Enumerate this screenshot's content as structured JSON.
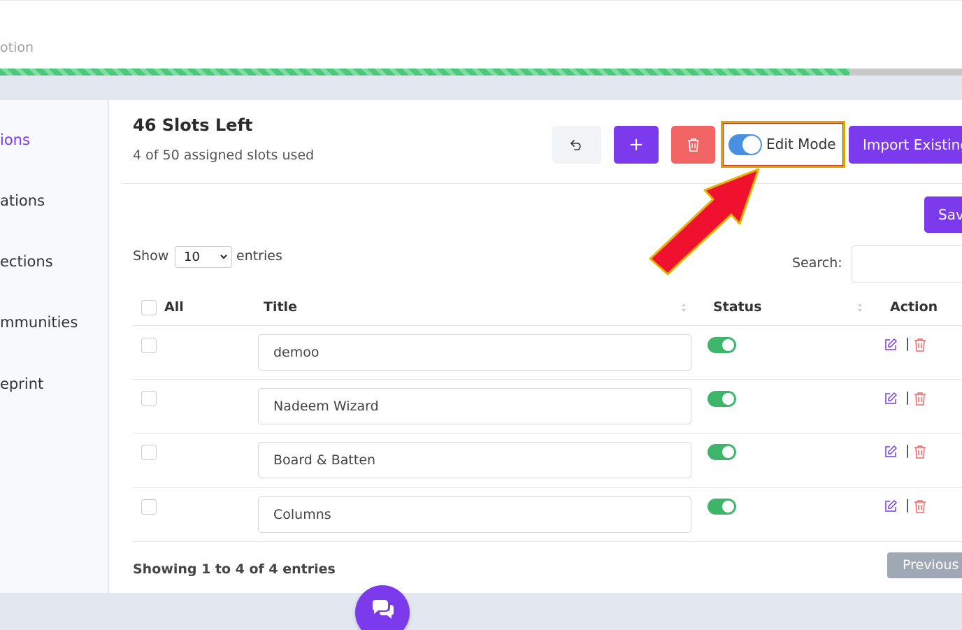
{
  "header": {
    "partial_text": "otion"
  },
  "progress": {
    "fraction": 0.883
  },
  "sidebar": {
    "items": [
      {
        "label": "ions",
        "active": true
      },
      {
        "label": "ations",
        "active": false
      },
      {
        "label": "ections",
        "active": false
      },
      {
        "label": "mmunities",
        "active": false
      },
      {
        "label": "eprint",
        "active": false
      }
    ]
  },
  "slots": {
    "title": "46 Slots Left",
    "subtitle": "4 of 50 assigned slots used"
  },
  "toolbar": {
    "undo_icon": "undo-icon",
    "add_label": "+",
    "delete_icon": "trash-icon",
    "edit_mode_label": "Edit Mode",
    "edit_mode_on": true,
    "import_label": "Import Existing",
    "save_label": "Save"
  },
  "table_controls": {
    "show_label": "Show",
    "page_size": "10",
    "entries_label": "entries",
    "search_label": "Search:"
  },
  "table": {
    "headers": {
      "all": "All",
      "title": "Title",
      "status": "Status",
      "action": "Action"
    },
    "rows": [
      {
        "title": "demoo",
        "status": true
      },
      {
        "title": "Nadeem Wizard",
        "status": true
      },
      {
        "title": "Board & Batten",
        "status": true
      },
      {
        "title": "Columns",
        "status": true
      }
    ],
    "action_separator": "|",
    "summary": "Showing 1 to 4 of 4 entries",
    "prev_label": "Previous"
  },
  "colors": {
    "accent": "#7c3aed",
    "danger": "#f36565",
    "success": "#3db66b",
    "annotation_arrow": "#f0112f"
  }
}
